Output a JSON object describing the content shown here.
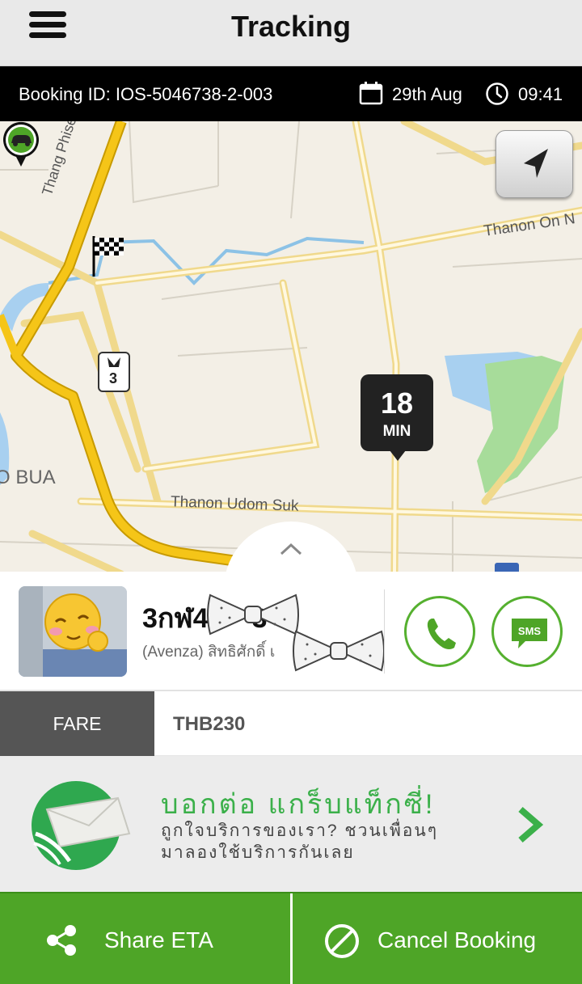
{
  "header": {
    "title": "Tracking"
  },
  "booking": {
    "id_label": "Booking ID: IOS-5046738-2-003",
    "date": "29th Aug",
    "time": "09:41"
  },
  "map": {
    "labels": {
      "road1": "Thang Phiset Chalo",
      "road2": "Thanon On N",
      "road3": "Thanon Udom Suk",
      "area": "O BUA",
      "route_shield": "3"
    },
    "eta": {
      "value": "18",
      "unit": "MIN"
    }
  },
  "driver": {
    "plate": "3กฬ4",
    "plate_suffix": "3",
    "name": "(Avenza) สิทธิศักดิ์ เ"
  },
  "actions": {
    "sms_label": "SMS"
  },
  "fare": {
    "label": "FARE",
    "value": "THB230"
  },
  "promo": {
    "headline": "บอกต่อ แกร็บแท็กซี่!",
    "line1": "ถูกใจบริการของเรา? ชวนเพื่อนๆ",
    "line2": "มาลองใช้บริการกันเลย"
  },
  "footer": {
    "share_label": "Share ETA",
    "cancel_label": "Cancel Booking"
  },
  "colors": {
    "brand_green": "#4ea527",
    "promo_green": "#3bb04a",
    "route_yellow": "#f5c518",
    "black_bar": "#000000"
  }
}
